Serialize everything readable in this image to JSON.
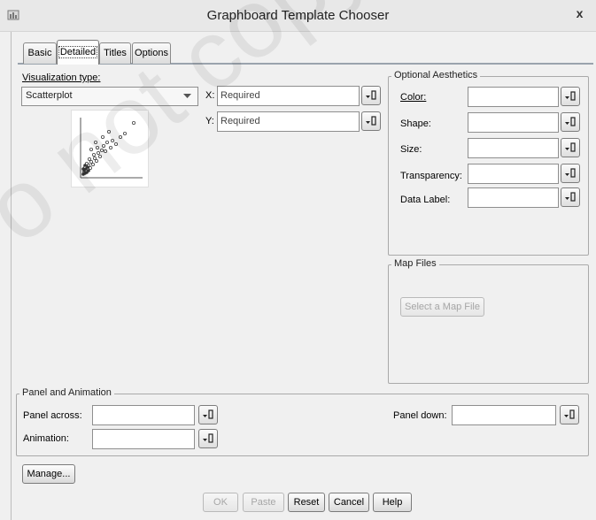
{
  "window": {
    "title": "Graphboard Template Chooser",
    "close_glyph": "x"
  },
  "tabs": [
    {
      "label": "Basic"
    },
    {
      "label": "Detailed",
      "selected": true
    },
    {
      "label": "Titles"
    },
    {
      "label": "Options"
    }
  ],
  "visualization": {
    "label": "Visualization type:",
    "selected": "Scatterplot",
    "preview_icon": "scatterplot-thumbnail"
  },
  "axes": {
    "x": {
      "label": "X:",
      "value": "Required"
    },
    "y": {
      "label": "Y:",
      "value": "Required"
    }
  },
  "optional_aesthetics": {
    "title": "Optional Aesthetics",
    "fields": [
      {
        "label": "Color:",
        "value": ""
      },
      {
        "label": "Shape:",
        "value": ""
      },
      {
        "label": "Size:",
        "value": ""
      },
      {
        "label": "Transparency:",
        "value": ""
      },
      {
        "label": "Data Label:",
        "value": ""
      }
    ]
  },
  "map_files": {
    "title": "Map Files",
    "button": "Select a Map File",
    "button_enabled": false
  },
  "panel_animation": {
    "title": "Panel and Animation",
    "panel_across": {
      "label": "Panel across:",
      "value": ""
    },
    "panel_down": {
      "label": "Panel down:",
      "value": ""
    },
    "animation": {
      "label": "Animation:",
      "value": ""
    }
  },
  "buttons": {
    "manage": "Manage...",
    "ok": "OK",
    "paste": "Paste",
    "reset": "Reset",
    "cancel": "Cancel",
    "help": "Help"
  },
  "watermark": "o not copy, po",
  "colors": {
    "tab_line": "#9aa3ad",
    "disabled_text": "#a6a6a6"
  }
}
